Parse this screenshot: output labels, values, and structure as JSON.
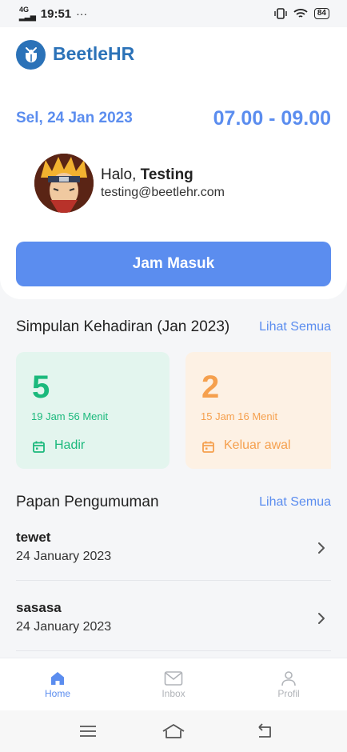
{
  "status_bar": {
    "signal": "4G",
    "time": "19:51",
    "dots": "···",
    "battery": "84"
  },
  "app": {
    "brand": "BeetleHR"
  },
  "shift": {
    "date": "Sel, 24 Jan 2023",
    "hours": "07.00 - 09.00"
  },
  "user": {
    "greeting": "Halo, ",
    "name": "Testing",
    "email": "testing@beetlehr.com"
  },
  "clock_in_button": "Jam Masuk",
  "attendance": {
    "title": "Simpulan Kehadiran (Jan 2023)",
    "see_all": "Lihat Semua",
    "cards": [
      {
        "count": "5",
        "duration": "19 Jam 56 Menit",
        "label": "Hadir",
        "color": "#1bb97c"
      },
      {
        "count": "2",
        "duration": "15 Jam 16 Menit",
        "label": "Keluar awal",
        "color": "#f5a04e"
      }
    ]
  },
  "announcements": {
    "title": "Papan Pengumuman",
    "see_all": "Lihat Semua",
    "items": [
      {
        "title": "tewet",
        "date": "24 January 2023"
      },
      {
        "title": "sasasa",
        "date": "24 January 2023"
      }
    ]
  },
  "bottom_nav": {
    "items": [
      {
        "label": "Home",
        "icon": "home-icon",
        "active": true
      },
      {
        "label": "Inbox",
        "icon": "mail-icon",
        "active": false
      },
      {
        "label": "Profil",
        "icon": "user-icon",
        "active": false
      }
    ]
  },
  "colors": {
    "primary": "#5b8def",
    "brand": "#2b72b8",
    "success": "#1bb97c",
    "warning": "#f5a04e"
  }
}
